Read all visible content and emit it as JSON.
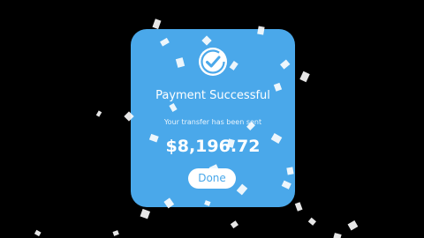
{
  "dialog": {
    "title": "Payment Successful",
    "subtitle": "Your transfer has been sent",
    "amount": "$8,196.72",
    "done_label": "Done",
    "icon": "checkmark-icon"
  },
  "colors": {
    "background": "#000000",
    "card": "#4aa8ea",
    "text": "#ffffff",
    "button_bg": "#ffffff",
    "button_text": "#4aa8ea"
  }
}
